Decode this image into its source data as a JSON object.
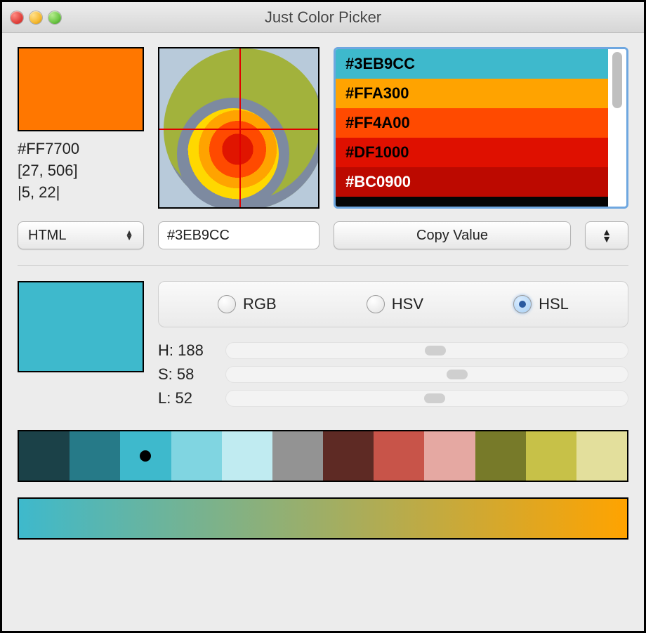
{
  "window": {
    "title": "Just Color Picker"
  },
  "current": {
    "swatch_color": "#FF7700",
    "hex_label": "#FF7700",
    "coords_label": "[27, 506]",
    "delta_label": "|5, 22|"
  },
  "format_select": {
    "value": "HTML"
  },
  "hex_input": {
    "value": "#3EB9CC"
  },
  "copy_button": {
    "label": "Copy Value"
  },
  "color_list": {
    "selected_index": 4,
    "items": [
      {
        "hex": "#3EB9CC",
        "bg": "#3EB9CC",
        "fg": "#000000"
      },
      {
        "hex": "#FFA300",
        "bg": "#FFA300",
        "fg": "#000000"
      },
      {
        "hex": "#FF4A00",
        "bg": "#FF4A00",
        "fg": "#000000"
      },
      {
        "hex": "#DF1000",
        "bg": "#DF1000",
        "fg": "#000000"
      },
      {
        "hex": "#BC0900",
        "bg": "#BC0900",
        "fg": "#FFFFFF",
        "selected": true
      },
      {
        "hex": "",
        "bg": "#050505",
        "fg": "#FFFFFF"
      }
    ]
  },
  "modes": {
    "options": [
      "RGB",
      "HSV",
      "HSL"
    ],
    "selected": "HSL"
  },
  "adjust": {
    "swatch_color": "#3EB9CC",
    "h": {
      "label": "H: 188",
      "value": 188,
      "max": 360
    },
    "s": {
      "label": "S: 58",
      "value": 58,
      "max": 100
    },
    "l": {
      "label": "L: 52",
      "value": 52,
      "max": 100
    }
  },
  "palette": {
    "active_index": 2,
    "colors": [
      "#1b4148",
      "#267a88",
      "#3eb9cc",
      "#80d5e1",
      "#c0ebf1",
      "#939393",
      "#5e2a24",
      "#c85449",
      "#e5a8a2",
      "#777a29",
      "#c7c148",
      "#e3df9c"
    ]
  },
  "gradient": {
    "from": "#3EB9CC",
    "to": "#FFA300"
  }
}
